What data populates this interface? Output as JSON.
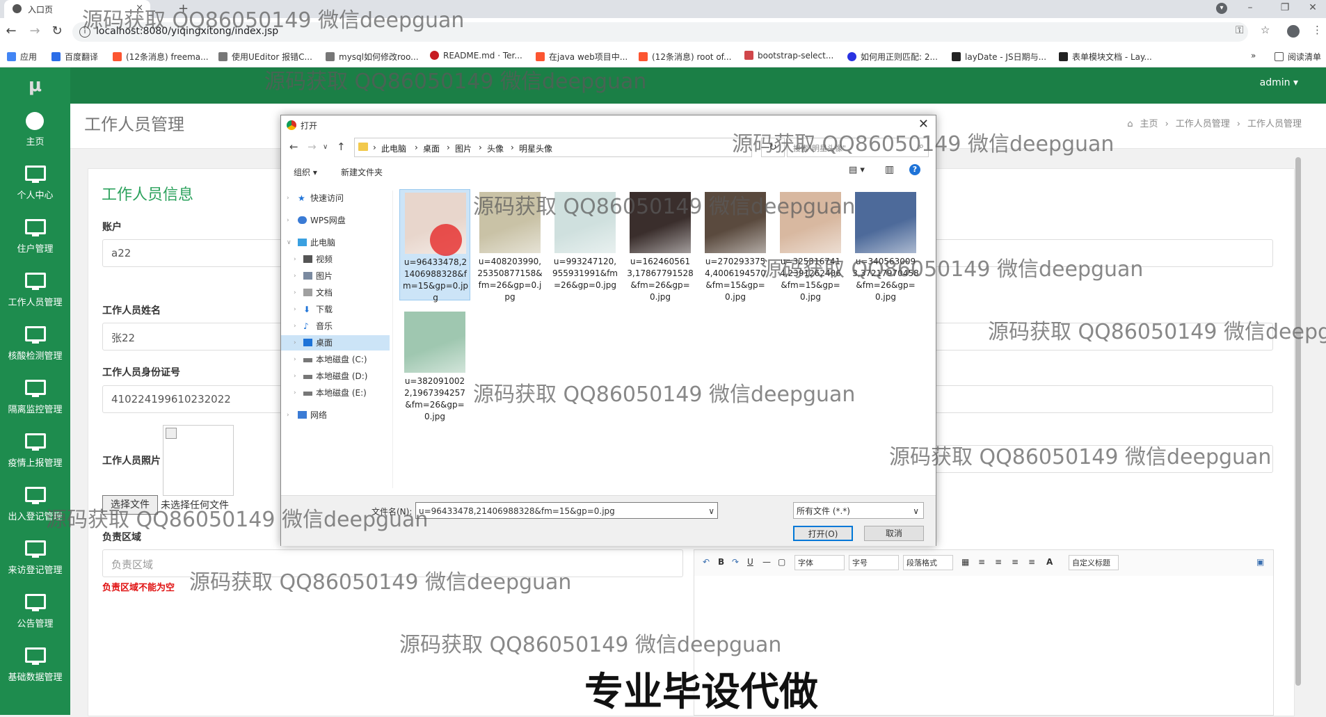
{
  "browser": {
    "tab_title": "入口页",
    "url": "localhost:8080/yiqingxitong/index.jsp",
    "bookmarks": [
      "应用",
      "百度翻译",
      "(12条消息) freema...",
      "使用UEditor 报错C...",
      "mysql如何修改roo...",
      "README.md · Ter...",
      "在java web项目中...",
      "(12条消息) root of...",
      "bootstrap-select...",
      "如何用正则匹配: 2...",
      "layDate - JS日期与...",
      "表单模块文档 - Lay..."
    ],
    "reading_list": "阅读清单",
    "more": "»"
  },
  "app": {
    "logo": "μ",
    "user": "admin ▾",
    "sidebar": [
      "主页",
      "个人中心",
      "住户管理",
      "工作人员管理",
      "核酸检测管理",
      "隔离监控管理",
      "疫情上报管理",
      "出入登记管理",
      "来访登记管理",
      "公告管理",
      "基础数据管理"
    ],
    "page_title": "工作人员管理",
    "breadcrumb": [
      "主页",
      "工作人员管理",
      "工作人员管理"
    ],
    "breadcrumb_sep": "›",
    "section_title": "工作人员信息",
    "form": {
      "account_label": "账户",
      "account_value": "a22",
      "name_label": "工作人员姓名",
      "name_value": "张22",
      "idcard_label": "工作人员身份证号",
      "idcard_value": "410224199610232022",
      "photo_label": "工作人员照片",
      "choose_file": "选择文件",
      "no_file": "未选择任何文件",
      "region_label": "负责区域",
      "region_placeholder": "负责区域",
      "region_error": "负责区域不能为空"
    },
    "editor": {
      "font": "字体",
      "size": "字号",
      "paragraph": "段落格式",
      "custom_title": "自定义标题",
      "bold": "B",
      "underline": "U",
      "font_color": "A"
    }
  },
  "dialog": {
    "title": "打开",
    "path": [
      "此电脑",
      "桌面",
      "图片",
      "头像",
      "明星头像"
    ],
    "search_placeholder": "搜索\"明星头像\"",
    "organize": "组织 ▾",
    "new_folder": "新建文件夹",
    "tree": [
      "快速访问",
      "WPS网盘",
      "此电脑",
      "视频",
      "图片",
      "文档",
      "下载",
      "音乐",
      "桌面",
      "本地磁盘 (C:)",
      "本地磁盘 (D:)",
      "本地磁盘 (E:)",
      "网络"
    ],
    "files": [
      {
        "name": "u=96433478,21406988328&fm=15&gp=0.jpg",
        "color": "#e8d6cc"
      },
      {
        "name": "u=408203990,25350877158&fm=26&gp=0.jpg",
        "color": "#c9c2a6"
      },
      {
        "name": "u=993247120,955931991&fm=26&gp=0.jpg",
        "color": "#cfe0de"
      },
      {
        "name": "u=1624605613,17867791528&fm=26&gp=0.jpg",
        "color": "#3a2e2c"
      },
      {
        "name": "u=2702933754,4006194570&fm=15&gp=0.jpg",
        "color": "#5a4a3e"
      },
      {
        "name": "u=3253167414,2391262406&fm=15&gp=0.jpg",
        "color": "#d8b8a0"
      },
      {
        "name": "u=3405630093,37217970458&fm=26&gp=0.jpg",
        "color": "#4d6a9a"
      },
      {
        "name": "u=3820910022,1967394257&fm=26&gp=0.jpg",
        "color": "#9fc7b0"
      }
    ],
    "filename_label": "文件名(N):",
    "filename_value": "u=96433478,21406988328&fm=15&gp=0.jpg",
    "filetype": "所有文件 (*.*)",
    "open_button": "打开(O)",
    "cancel_button": "取消"
  },
  "overlay": {
    "watermark": "源码获取 QQ86050149 微信deepguan",
    "watermark_clipped": "源码获取 QQ86050149 微信deepg",
    "promo": "专业毕设代做"
  },
  "colors": {
    "accent": "#1e8c4e",
    "topbar": "#1b7f46",
    "error": "#e01010",
    "section": "#2aa15b"
  }
}
